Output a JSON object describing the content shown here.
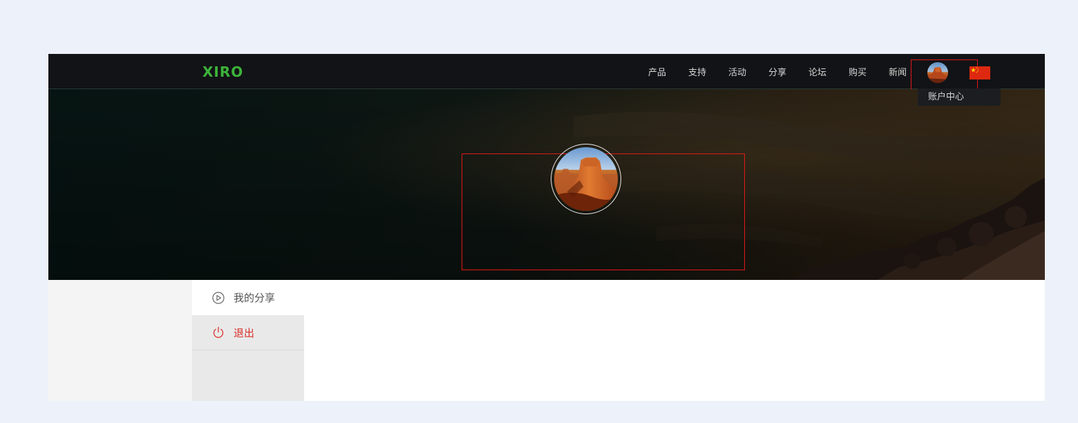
{
  "header": {
    "logo": "XIRO",
    "nav": [
      "产品",
      "支持",
      "活动",
      "分享",
      "论坛",
      "购买",
      "新闻"
    ],
    "account_dropdown": "账户中心"
  },
  "sidebar": {
    "items": [
      {
        "label": "我的分享",
        "icon": "play-circle-icon"
      },
      {
        "label": "退出",
        "icon": "power-icon"
      }
    ]
  },
  "colors": {
    "nav_bg": "#121316",
    "logo_green": "#3cb43a",
    "accent_red": "#d9302b",
    "highlight_border": "#e01818"
  }
}
